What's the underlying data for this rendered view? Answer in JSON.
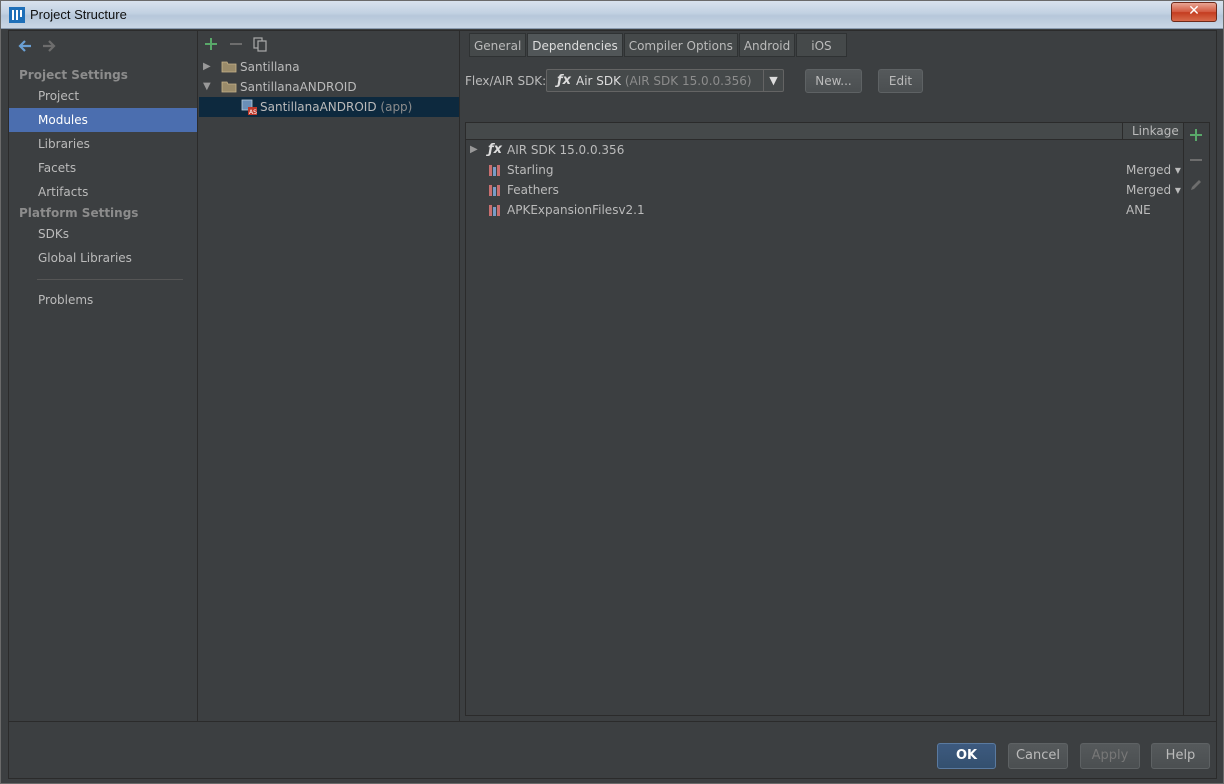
{
  "window": {
    "title": "Project Structure",
    "close_label": "✕",
    "app_icon": "intellij-icon"
  },
  "nav": {
    "back_icon": "arrow-left-icon",
    "forward_icon": "arrow-right-icon",
    "project_settings_header": "Project Settings",
    "platform_settings_header": "Platform Settings",
    "items": {
      "project": "Project",
      "modules": "Modules",
      "libraries": "Libraries",
      "facets": "Facets",
      "artifacts": "Artifacts",
      "sdks": "SDKs",
      "global_libraries": "Global Libraries",
      "problems": "Problems"
    },
    "selected": "modules"
  },
  "tree": {
    "tools": [
      "add-icon",
      "remove-icon",
      "copy-icon"
    ],
    "nodes": [
      {
        "label": "Santillana",
        "suffix": "",
        "expanded": false,
        "icon": "folder-icon"
      },
      {
        "label": "SantillanaANDROID",
        "suffix": "",
        "expanded": true,
        "icon": "folder-icon"
      },
      {
        "label": "SantillanaANDROID",
        "suffix": " (app)",
        "icon": "air-app-icon",
        "selected": true
      }
    ]
  },
  "tabs": [
    "General",
    "Dependencies",
    "Compiler Options",
    "Android",
    "iOS"
  ],
  "active_tab": "Dependencies",
  "sdk": {
    "label": "Flex/AIR SDK:",
    "label_mnemonic": "S",
    "value": "Air SDK",
    "value_detail": " (AIR SDK 15.0.0.356)",
    "new_button": "New...",
    "edit_button": "Edit"
  },
  "dependencies": {
    "linkage_header": "Linkage",
    "rows": [
      {
        "name": "AIR SDK 15.0.0.356",
        "icon": "fx-sdk-icon",
        "expandable": true,
        "linkage": ""
      },
      {
        "name": "Starling",
        "icon": "library-icon",
        "expandable": false,
        "linkage": "Merged ▾"
      },
      {
        "name": "Feathers",
        "icon": "library-icon",
        "expandable": false,
        "linkage": "Merged ▾"
      },
      {
        "name": "APKExpansionFilesv2.1",
        "icon": "library-icon",
        "expandable": false,
        "linkage": "ANE"
      }
    ]
  },
  "side_tools": [
    "add-icon",
    "remove-icon",
    "edit-icon"
  ],
  "footer": {
    "ok": "OK",
    "cancel": "Cancel",
    "apply": "Apply",
    "help": "Help"
  },
  "colors": {
    "background": "#3c3f41",
    "selection": "#4b6eaf",
    "tree_selection": "#0d293e",
    "add_green": "#59a869"
  }
}
